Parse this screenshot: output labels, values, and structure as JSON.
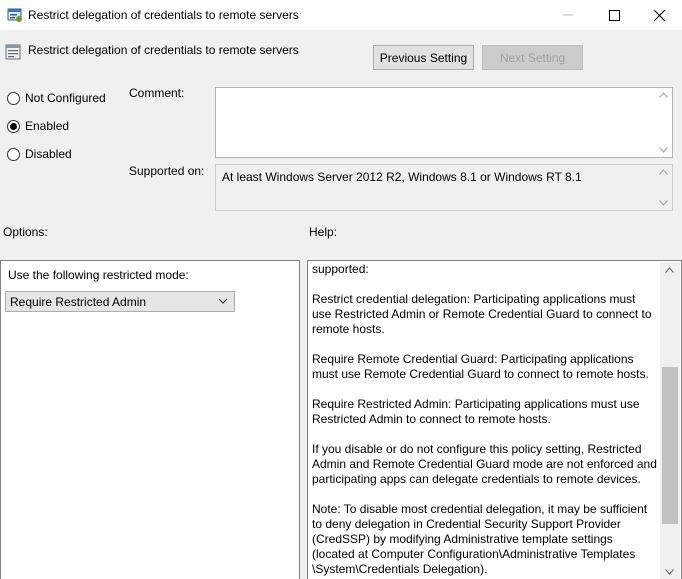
{
  "window": {
    "title": "Restrict delegation of credentials to remote servers",
    "minimize_glyph": "—",
    "maximize_glyph": "☐",
    "close_glyph": "✕"
  },
  "header": {
    "setting_title": "Restrict delegation of credentials to remote servers",
    "previous_label": "Previous Setting",
    "next_label": "Next Setting"
  },
  "state": {
    "options": [
      "Not Configured",
      "Enabled",
      "Disabled"
    ],
    "selected": "Enabled"
  },
  "comment": {
    "label": "Comment:",
    "value": ""
  },
  "supported_on": {
    "label": "Supported on:",
    "value": "At least Windows Server 2012 R2, Windows 8.1 or Windows RT 8.1"
  },
  "options_section": {
    "label": "Options:",
    "mode_label": "Use the following restricted mode:",
    "mode_value": "Require Restricted Admin"
  },
  "help_section": {
    "label": "Help:",
    "paragraphs": [
      "supported:",
      "Restrict credential delegation: Participating applications must use Restricted Admin or Remote Credential Guard to connect to remote hosts.",
      "Require Remote Credential Guard: Participating applications must use Remote Credential Guard to connect to remote hosts.",
      "Require Restricted Admin: Participating applications must use Restricted Admin to connect to remote hosts.",
      "If you disable or do not configure this policy setting, Restricted Admin and Remote Credential Guard mode are not enforced and participating apps can delegate credentials to remote devices.",
      "Note: To disable most credential delegation, it may be sufficient to deny delegation in Credential Security Support Provider (CredSSP) by modifying Administrative template settings (located at Computer Configuration\\Administrative Templates \\System\\Credentials Delegation)."
    ]
  },
  "icons": {
    "app": "policy-settings-icon",
    "setting": "policy-setting-icon"
  },
  "colors": {
    "window_bg": "#f0f0f0",
    "disabled_text": "#a0a0a0"
  }
}
